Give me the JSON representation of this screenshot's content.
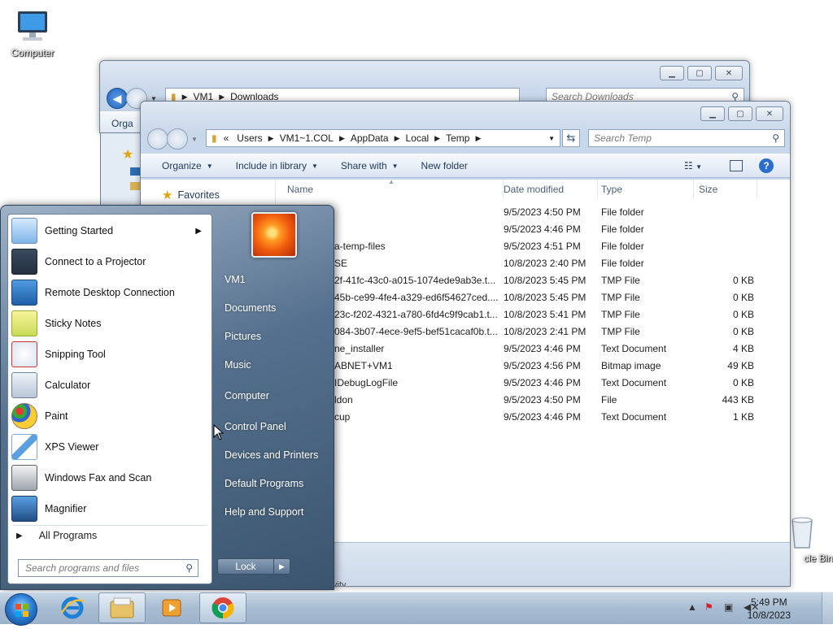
{
  "desktop": {
    "icons": [
      {
        "label": "Computer"
      },
      {
        "label": "Recycle Bin",
        "visible_label": "cle Bin"
      }
    ]
  },
  "window_back": {
    "address": [
      "VM1",
      "Downloads"
    ],
    "search_placeholder": "Search Downloads",
    "organize_fragment": "Orga"
  },
  "window_front": {
    "address": [
      "«",
      "Users",
      "VM1~1.COL",
      "AppData",
      "Local",
      "Temp"
    ],
    "search_placeholder": "Search Temp",
    "commands": [
      "Organize",
      "Include in library",
      "Share with",
      "New folder"
    ],
    "nav": {
      "favorites": "Favorites"
    },
    "columns": [
      "Name",
      "Date modified",
      "Type",
      "Size"
    ],
    "files": [
      {
        "name": "",
        "date": "9/5/2023 4:50 PM",
        "type": "File folder",
        "size": ""
      },
      {
        "name": "",
        "date": "9/5/2023 4:46 PM",
        "type": "File folder",
        "size": ""
      },
      {
        "name": "a-temp-files",
        "date": "9/5/2023 4:51 PM",
        "type": "File folder",
        "size": ""
      },
      {
        "name": "SE",
        "date": "10/8/2023 2:40 PM",
        "type": "File folder",
        "size": ""
      },
      {
        "name": "2f-41fc-43c0-a015-1074ede9ab3e.t...",
        "date": "10/8/2023 5:45 PM",
        "type": "TMP File",
        "size": "0 KB"
      },
      {
        "name": "45b-ce99-4fe4-a329-ed6f54627ced....",
        "date": "10/8/2023 5:45 PM",
        "type": "TMP File",
        "size": "0 KB"
      },
      {
        "name": "23c-f202-4321-a780-6fd4c9f9cab1.t...",
        "date": "10/8/2023 5:41 PM",
        "type": "TMP File",
        "size": "0 KB"
      },
      {
        "name": "084-3b07-4ece-9ef5-bef51cacaf0b.t...",
        "date": "10/8/2023 2:41 PM",
        "type": "TMP File",
        "size": "0 KB"
      },
      {
        "name": "ne_installer",
        "date": "9/5/2023 4:46 PM",
        "type": "Text Document",
        "size": "4 KB"
      },
      {
        "name": "ABNET+VM1",
        "date": "9/5/2023 4:56 PM",
        "type": "Bitmap image",
        "size": "49 KB"
      },
      {
        "name": "IDebugLogFile",
        "date": "9/5/2023 4:46 PM",
        "type": "Text Document",
        "size": "0 KB"
      },
      {
        "name": "ldon",
        "date": "9/5/2023 4:50 PM",
        "type": "File",
        "size": "443 KB"
      },
      {
        "name": "cup",
        "date": "9/5/2023 4:46 PM",
        "type": "Text Document",
        "size": "1 KB"
      }
    ],
    "status_fragment": "vity"
  },
  "start_menu": {
    "programs": [
      {
        "label": "Getting Started",
        "has_submenu": true,
        "icon": "getting-started-icon"
      },
      {
        "label": "Connect to a Projector",
        "icon": "projector-icon"
      },
      {
        "label": "Remote Desktop Connection",
        "icon": "remote-desktop-icon"
      },
      {
        "label": "Sticky Notes",
        "icon": "sticky-notes-icon"
      },
      {
        "label": "Snipping Tool",
        "icon": "snipping-tool-icon"
      },
      {
        "label": "Calculator",
        "icon": "calculator-icon"
      },
      {
        "label": "Paint",
        "icon": "paint-icon"
      },
      {
        "label": "XPS Viewer",
        "icon": "xps-viewer-icon"
      },
      {
        "label": "Windows Fax and Scan",
        "icon": "fax-scan-icon"
      },
      {
        "label": "Magnifier",
        "icon": "magnifier-icon"
      }
    ],
    "all_programs": "All Programs",
    "search_placeholder": "Search programs and files",
    "right_items": [
      "VM1",
      "Documents",
      "Pictures",
      "Music",
      "Computer",
      "Control Panel",
      "Devices and Printers",
      "Default Programs",
      "Help and Support"
    ],
    "lock_label": "Lock"
  },
  "taskbar": {
    "time": "5:49 PM",
    "date": "10/8/2023"
  }
}
